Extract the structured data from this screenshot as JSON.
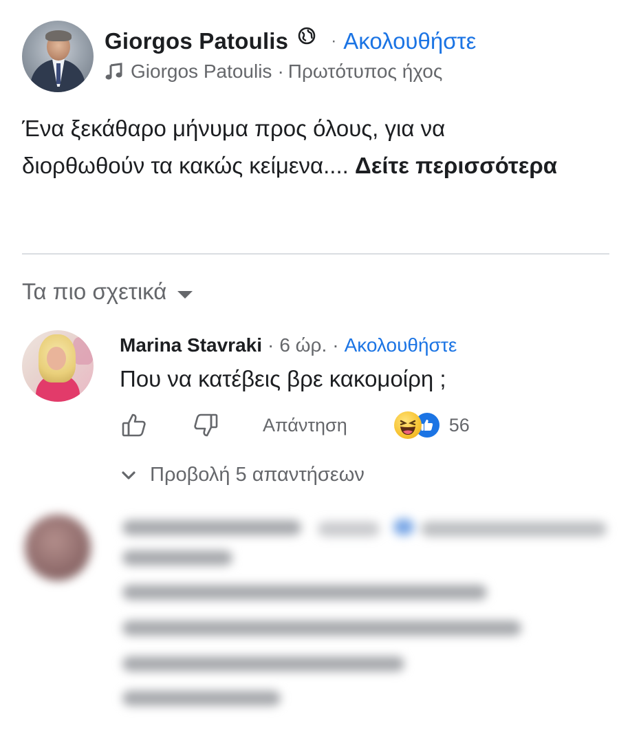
{
  "post": {
    "author": "Giorgos Patoulis",
    "follow_label": "Ακολουθήστε",
    "dot": "·",
    "audio_author": "Giorgos Patoulis",
    "audio_separator": "·",
    "audio_label": "Πρωτότυπος ήχος",
    "text_line1": "Ένα ξεκάθαρο μήνυμα προς όλους, για να",
    "text_line2": "διορθωθούν τα κακώς κείμενα.... ",
    "see_more": "Δείτε περισσότερα",
    "icons": {
      "privacy": "globe-icon",
      "audio": "music-note-icon"
    }
  },
  "comments_sort": {
    "label": "Τα πιο σχετικά",
    "icon": "caret-down-icon"
  },
  "comment": {
    "author": "Marina Stavraki",
    "dot1": "·",
    "time": "6 ώρ.",
    "dot2": "·",
    "follow_label": "Ακολουθήστε",
    "text": "Που να κατέβεις βρε κακομοίρη ;",
    "reply_label": "Απάντηση",
    "reaction_count": "56",
    "reactions": [
      "haha",
      "like"
    ],
    "view_replies_label": "Προβολή 5 απαντήσεων"
  },
  "colors": {
    "link_blue": "#1b74e4",
    "text_primary": "#1c1e21",
    "text_secondary": "#65676b"
  }
}
